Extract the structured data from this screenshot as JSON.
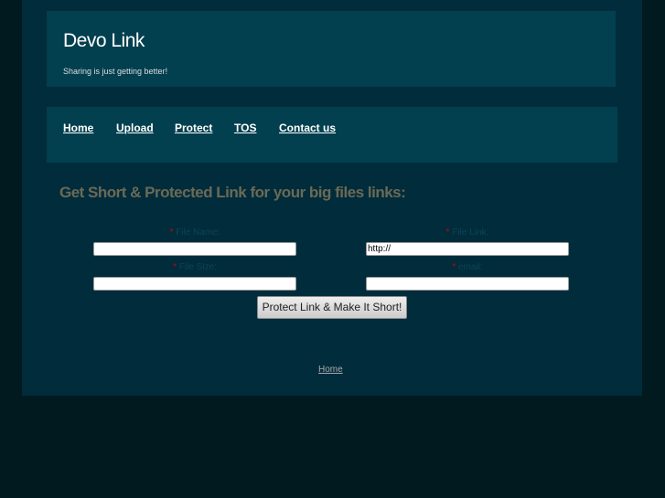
{
  "header": {
    "title": "Devo Link",
    "tagline": "Sharing is just getting better!"
  },
  "nav": [
    "Home",
    "Upload",
    "Protect",
    "TOS",
    "Contact us"
  ],
  "form": {
    "heading": "Get Short & Protected Link for your big files links:",
    "required_mark": "*",
    "file_name_label": "File Name:",
    "file_link_label": "File Link:",
    "file_link_value": "http://",
    "file_size_label": "File Size:",
    "email_label": "email:",
    "submit": "Protect Link & Make It Short!"
  },
  "footer": {
    "home": "Home"
  }
}
